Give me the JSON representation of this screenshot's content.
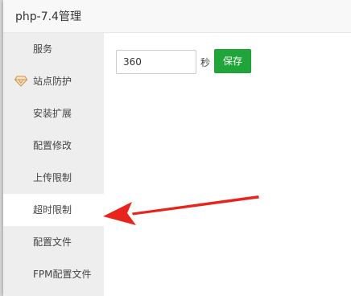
{
  "window": {
    "title": "php-7.4管理"
  },
  "sidebar": {
    "items": [
      {
        "label": "服务"
      },
      {
        "label": "站点防护",
        "icon": "shield-diamond-icon"
      },
      {
        "label": "安装扩展"
      },
      {
        "label": "配置修改"
      },
      {
        "label": "上传限制"
      },
      {
        "label": "超时限制",
        "active": true
      },
      {
        "label": "配置文件"
      },
      {
        "label": "FPM配置文件"
      }
    ]
  },
  "timeout": {
    "value": "360",
    "unit": "秒",
    "save_label": "保存"
  },
  "colors": {
    "accent": "#20a53a",
    "arrow": "#e8251c",
    "sidebar_bg": "#eeeeee",
    "header_bg": "#f8f8f8"
  }
}
